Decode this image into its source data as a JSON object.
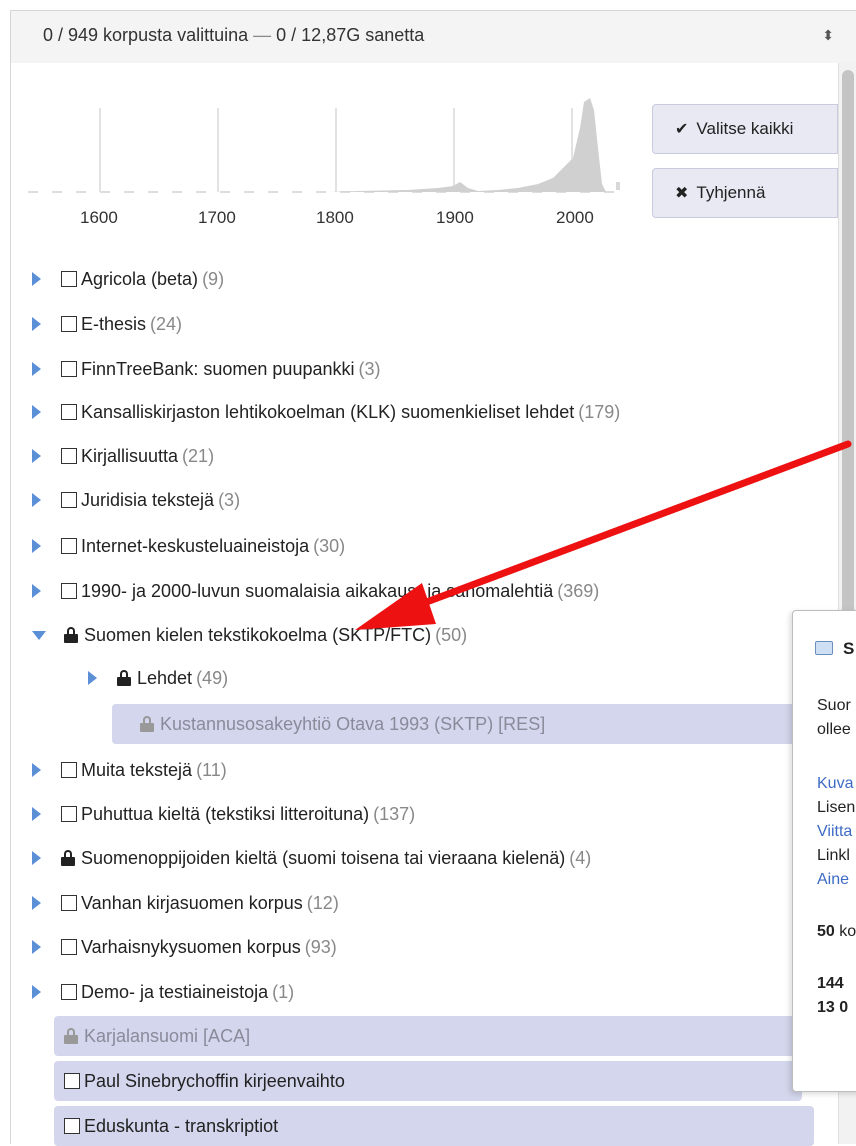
{
  "header": {
    "summary": "0 / 949 korpusta valittuina",
    "dash": " — ",
    "tokens": "0 / 12,87G sanetta",
    "caret": "⬍"
  },
  "histogram": {
    "axis_labels": [
      "1600",
      "1700",
      "1800",
      "1900",
      "2000"
    ]
  },
  "buttons": {
    "select_all": "Valitse kaikki",
    "clear": "Tyhjennä"
  },
  "tree": [
    {
      "label": "Agricola (beta)",
      "count": "(9)"
    },
    {
      "label": "E-thesis",
      "count": "(24)"
    },
    {
      "label": "FinnTreeBank: suomen puupankki",
      "count": "(3)"
    },
    {
      "label": "Kansalliskirjaston lehtikokoelman (KLK) suomenkieliset lehdet",
      "count": "(179)"
    },
    {
      "label": "Kirjallisuutta",
      "count": "(21)"
    },
    {
      "label": "Juridisia tekstejä",
      "count": "(3)"
    },
    {
      "label": "Internet-keskusteluaineistoja",
      "count": "(30)"
    },
    {
      "label": "1990- ja 2000-luvun suomalaisia aikakaus- ja sanomalehtiä",
      "count": "(369)"
    },
    {
      "label": "Suomen kielen tekstikokoelma (SKTP/FTC)",
      "count": "(50)"
    },
    {
      "label": "Lehdet",
      "count": "(49)"
    },
    {
      "label": "Kustannusosakeyhtiö Otava 1993 (SKTP) [RES]",
      "count": ""
    },
    {
      "label": "Muita tekstejä",
      "count": "(11)"
    },
    {
      "label": "Puhuttua kieltä (tekstiksi litteroituna)",
      "count": "(137)"
    },
    {
      "label": "Suomenoppijoiden kieltä (suomi toisena tai vieraana kielenä)",
      "count": "(4)"
    },
    {
      "label": "Vanhan kirjasuomen korpus",
      "count": "(12)"
    },
    {
      "label": "Varhaisnykysuomen korpus",
      "count": "(93)"
    },
    {
      "label": "Demo- ja testiaineistoja",
      "count": "(1)"
    },
    {
      "label": "Karjalansuomi [ACA]",
      "count": ""
    },
    {
      "label": "Paul Sinebrychoffin kirjeenvaihto",
      "count": ""
    },
    {
      "label": "Eduskunta - transkriptiot",
      "count": ""
    }
  ],
  "popup": {
    "title": "S",
    "desc1": "Suor",
    "desc2": "ollee",
    "l1": "Kuva",
    "l2": "Lisen",
    "l3": "Viitta",
    "l4": "Linkl",
    "l5": "Aine",
    "c1_num": "50",
    "c1_rest": " ko",
    "c2": "144",
    "c3": "13 0"
  }
}
